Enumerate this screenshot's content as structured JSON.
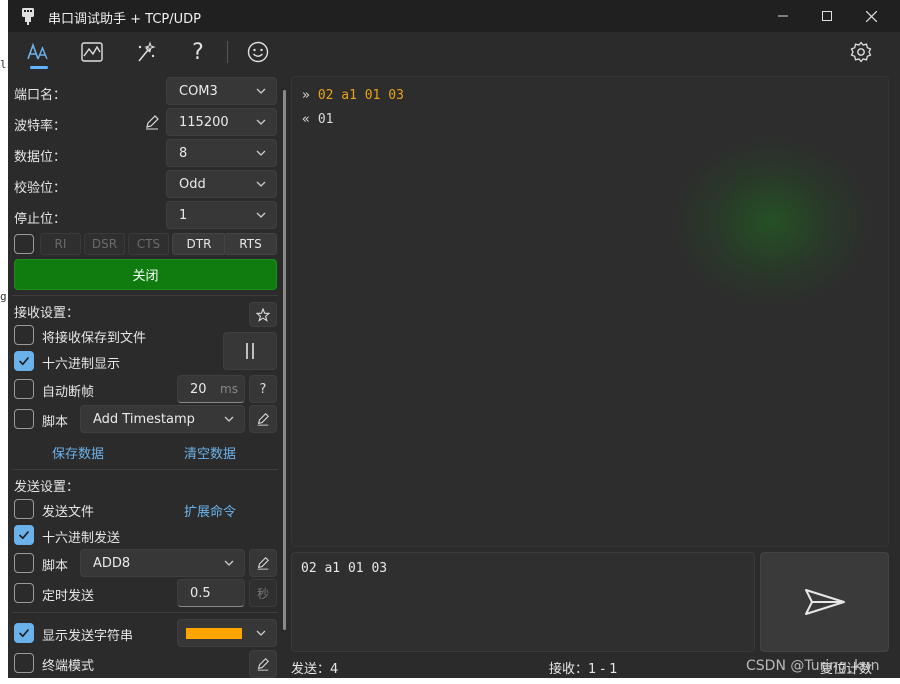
{
  "window": {
    "title": "串口调试助手 + TCP/UDP"
  },
  "toolbar": {
    "icons": [
      "text-style-icon",
      "chart-icon",
      "magic-icon",
      "help-icon",
      "smiley-icon",
      "settings-icon"
    ],
    "help_glyph": "?"
  },
  "serial": {
    "port_label": "端口名：",
    "port_value": "COM3",
    "baud_label": "波特率：",
    "baud_value": "115200",
    "databits_label": "数据位：",
    "databits_value": "8",
    "parity_label": "校验位：",
    "parity_value": "Odd",
    "stopbits_label": "停止位：",
    "stopbits_value": "1",
    "signals": [
      "RI",
      "DSR",
      "CTS",
      "DTR",
      "RTS"
    ],
    "close_label": "关闭"
  },
  "receive": {
    "section_label": "接收设置：",
    "save_to_file_label": "将接收保存到文件",
    "hex_display_label": "十六进制显示",
    "auto_frame_label": "自动断帧",
    "auto_frame_value": "20",
    "auto_frame_unit": "ms",
    "help_glyph": "?",
    "script_label": "脚本",
    "script_value": "Add Timestamp",
    "save_data_label": "保存数据",
    "clear_data_label": "清空数据"
  },
  "send": {
    "section_label": "发送设置：",
    "send_file_label": "发送文件",
    "extend_cmd_label": "扩展命令",
    "hex_send_label": "十六进制发送",
    "script_label": "脚本",
    "script_value": "ADD8",
    "timed_label": "定时发送",
    "timed_value": "0.5",
    "timed_unit": "秒",
    "show_string_label": "显示发送字符串",
    "show_string_color": "#FFA500",
    "terminal_mode_label": "终端模式",
    "input_text": "02 a1 01 03"
  },
  "log": [
    {
      "dir": "»",
      "text": "02 a1 01 03",
      "type": "sent"
    },
    {
      "dir": "«",
      "text": "01",
      "type": "recv"
    }
  ],
  "status": {
    "sent": "发送：4",
    "received": "接收：1 - 1",
    "reset": "复位计数"
  },
  "watermark": "CSDN @Turing_kun",
  "background_fragments": [
    "ls",
    "g"
  ],
  "colors": {
    "accent": "#6cb2ea",
    "open_button": "#107c10",
    "sent_text": "#e8a317"
  }
}
